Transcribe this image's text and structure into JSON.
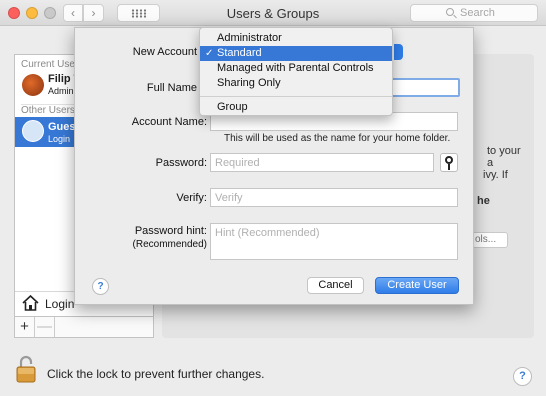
{
  "window": {
    "title": "Users & Groups",
    "search_placeholder": "Search",
    "back_glyph": "‹",
    "forward_glyph": "›"
  },
  "sidebar": {
    "current_section": "Current Use",
    "current_user": {
      "name": "Filip T",
      "role": "Admin"
    },
    "other_section": "Other Users",
    "guest_user": {
      "name": "Gues",
      "role": "Login"
    },
    "login_options": "Login",
    "add_glyph": "+",
    "remove_glyph": "—"
  },
  "background": {
    "line1": "to your",
    "line2": "a",
    "line3": "ivy. If",
    "line4": "he",
    "button": "ols..."
  },
  "lock": {
    "text": "Click the lock to prevent further changes."
  },
  "help_glyph": "?",
  "sheet": {
    "new_account_label": "New Account",
    "full_name_label": "Full Name",
    "full_name_value": "",
    "account_name_label": "Account Name:",
    "account_name_value": "",
    "account_name_note": "This will be used as the name for your home folder.",
    "password_label": "Password:",
    "password_placeholder": "Required",
    "verify_label": "Verify:",
    "verify_placeholder": "Verify",
    "hint_label": "Password hint:",
    "hint_sub": "(Recommended)",
    "hint_placeholder": "Hint (Recommended)",
    "cancel": "Cancel",
    "create": "Create User"
  },
  "account_menu": {
    "items": [
      "Administrator",
      "Standard",
      "Managed with Parental Controls",
      "Sharing Only"
    ],
    "extra": "Group",
    "selected_index": 1,
    "check": "✓"
  },
  "colors": {
    "accent": "#3778d6",
    "close": "#fc605c",
    "minimize": "#fdbc40"
  },
  "icons": [
    "search-icon",
    "grid-icon",
    "house-icon",
    "lock-icon",
    "key-icon",
    "help-icon",
    "checkmark-icon"
  ]
}
